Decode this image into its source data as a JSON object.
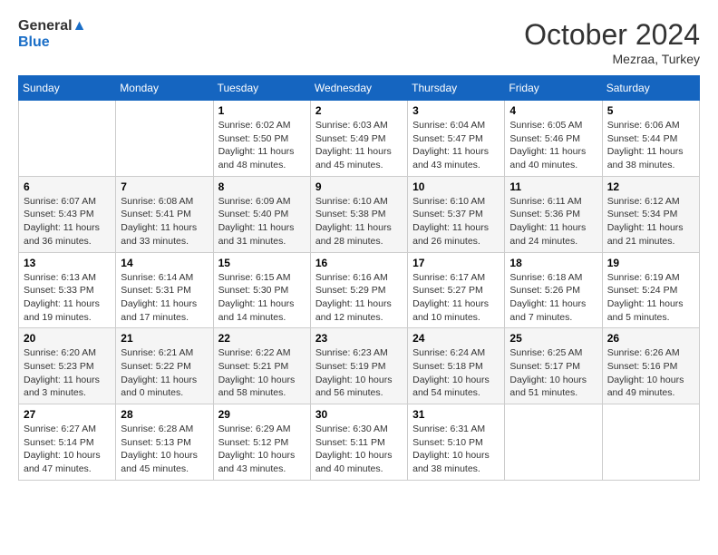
{
  "logo": {
    "line1": "General",
    "line2": "Blue"
  },
  "title": "October 2024",
  "location": "Mezraa, Turkey",
  "days_of_week": [
    "Sunday",
    "Monday",
    "Tuesday",
    "Wednesday",
    "Thursday",
    "Friday",
    "Saturday"
  ],
  "weeks": [
    [
      {
        "day": "",
        "text": ""
      },
      {
        "day": "",
        "text": ""
      },
      {
        "day": "1",
        "text": "Sunrise: 6:02 AM\nSunset: 5:50 PM\nDaylight: 11 hours and 48 minutes."
      },
      {
        "day": "2",
        "text": "Sunrise: 6:03 AM\nSunset: 5:49 PM\nDaylight: 11 hours and 45 minutes."
      },
      {
        "day": "3",
        "text": "Sunrise: 6:04 AM\nSunset: 5:47 PM\nDaylight: 11 hours and 43 minutes."
      },
      {
        "day": "4",
        "text": "Sunrise: 6:05 AM\nSunset: 5:46 PM\nDaylight: 11 hours and 40 minutes."
      },
      {
        "day": "5",
        "text": "Sunrise: 6:06 AM\nSunset: 5:44 PM\nDaylight: 11 hours and 38 minutes."
      }
    ],
    [
      {
        "day": "6",
        "text": "Sunrise: 6:07 AM\nSunset: 5:43 PM\nDaylight: 11 hours and 36 minutes."
      },
      {
        "day": "7",
        "text": "Sunrise: 6:08 AM\nSunset: 5:41 PM\nDaylight: 11 hours and 33 minutes."
      },
      {
        "day": "8",
        "text": "Sunrise: 6:09 AM\nSunset: 5:40 PM\nDaylight: 11 hours and 31 minutes."
      },
      {
        "day": "9",
        "text": "Sunrise: 6:10 AM\nSunset: 5:38 PM\nDaylight: 11 hours and 28 minutes."
      },
      {
        "day": "10",
        "text": "Sunrise: 6:10 AM\nSunset: 5:37 PM\nDaylight: 11 hours and 26 minutes."
      },
      {
        "day": "11",
        "text": "Sunrise: 6:11 AM\nSunset: 5:36 PM\nDaylight: 11 hours and 24 minutes."
      },
      {
        "day": "12",
        "text": "Sunrise: 6:12 AM\nSunset: 5:34 PM\nDaylight: 11 hours and 21 minutes."
      }
    ],
    [
      {
        "day": "13",
        "text": "Sunrise: 6:13 AM\nSunset: 5:33 PM\nDaylight: 11 hours and 19 minutes."
      },
      {
        "day": "14",
        "text": "Sunrise: 6:14 AM\nSunset: 5:31 PM\nDaylight: 11 hours and 17 minutes."
      },
      {
        "day": "15",
        "text": "Sunrise: 6:15 AM\nSunset: 5:30 PM\nDaylight: 11 hours and 14 minutes."
      },
      {
        "day": "16",
        "text": "Sunrise: 6:16 AM\nSunset: 5:29 PM\nDaylight: 11 hours and 12 minutes."
      },
      {
        "day": "17",
        "text": "Sunrise: 6:17 AM\nSunset: 5:27 PM\nDaylight: 11 hours and 10 minutes."
      },
      {
        "day": "18",
        "text": "Sunrise: 6:18 AM\nSunset: 5:26 PM\nDaylight: 11 hours and 7 minutes."
      },
      {
        "day": "19",
        "text": "Sunrise: 6:19 AM\nSunset: 5:24 PM\nDaylight: 11 hours and 5 minutes."
      }
    ],
    [
      {
        "day": "20",
        "text": "Sunrise: 6:20 AM\nSunset: 5:23 PM\nDaylight: 11 hours and 3 minutes."
      },
      {
        "day": "21",
        "text": "Sunrise: 6:21 AM\nSunset: 5:22 PM\nDaylight: 11 hours and 0 minutes."
      },
      {
        "day": "22",
        "text": "Sunrise: 6:22 AM\nSunset: 5:21 PM\nDaylight: 10 hours and 58 minutes."
      },
      {
        "day": "23",
        "text": "Sunrise: 6:23 AM\nSunset: 5:19 PM\nDaylight: 10 hours and 56 minutes."
      },
      {
        "day": "24",
        "text": "Sunrise: 6:24 AM\nSunset: 5:18 PM\nDaylight: 10 hours and 54 minutes."
      },
      {
        "day": "25",
        "text": "Sunrise: 6:25 AM\nSunset: 5:17 PM\nDaylight: 10 hours and 51 minutes."
      },
      {
        "day": "26",
        "text": "Sunrise: 6:26 AM\nSunset: 5:16 PM\nDaylight: 10 hours and 49 minutes."
      }
    ],
    [
      {
        "day": "27",
        "text": "Sunrise: 6:27 AM\nSunset: 5:14 PM\nDaylight: 10 hours and 47 minutes."
      },
      {
        "day": "28",
        "text": "Sunrise: 6:28 AM\nSunset: 5:13 PM\nDaylight: 10 hours and 45 minutes."
      },
      {
        "day": "29",
        "text": "Sunrise: 6:29 AM\nSunset: 5:12 PM\nDaylight: 10 hours and 43 minutes."
      },
      {
        "day": "30",
        "text": "Sunrise: 6:30 AM\nSunset: 5:11 PM\nDaylight: 10 hours and 40 minutes."
      },
      {
        "day": "31",
        "text": "Sunrise: 6:31 AM\nSunset: 5:10 PM\nDaylight: 10 hours and 38 minutes."
      },
      {
        "day": "",
        "text": ""
      },
      {
        "day": "",
        "text": ""
      }
    ]
  ]
}
